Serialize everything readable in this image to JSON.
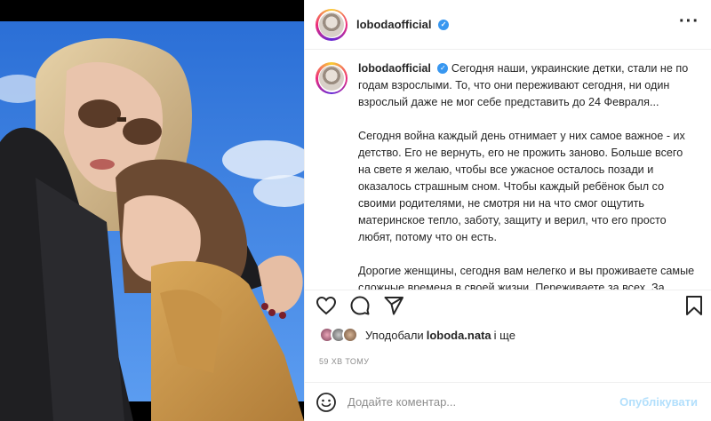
{
  "post": {
    "username": "lobodaofficial",
    "verified_icon": "verified-badge-icon",
    "more_icon": "more-options-icon"
  },
  "caption": {
    "username": "lobodaofficial",
    "paragraphs": [
      "Сегодня наши, украинские детки, стали не по годам взрослыми. То, что они переживают сегодня, ни один взрослый даже не мог себе представить до 24 Февраля...",
      "Сегодня война каждый день отнимает у них самое важное - их детство. Его не вернуть, его не прожить заново. Больше всего на свете я желаю, чтобы все ужасное осталось позади и оказалось страшным сном. Чтобы каждый ребёнок был со своими родителями, не смотря ни на что смог ощутить материнское тепло, заботу, защиту и верил, что его просто любят, потому что он есть.",
      "Дорогие женщины, сегодня вам нелегко и вы проживаете самые сложные времена в своей жизни. Переживаете за всех. За детей, в первую очередь. Но наши дети, во все"
    ]
  },
  "actions": {
    "like_icon": "heart-icon",
    "comment_icon": "comment-icon",
    "share_icon": "share-icon",
    "save_icon": "bookmark-icon"
  },
  "likes": {
    "prefix": "Уподобали",
    "user": "loboda.nata",
    "suffix": "і ще"
  },
  "timestamp": "59 ХВ ТОМУ",
  "comment": {
    "emoji_icon": "emoji-icon",
    "placeholder": "Додайте коментар...",
    "post_label": "Опублікувати"
  },
  "colors": {
    "verified": "#3897f0",
    "post_button_disabled": "#b2dffc",
    "muted_text": "#8e8e8e"
  }
}
